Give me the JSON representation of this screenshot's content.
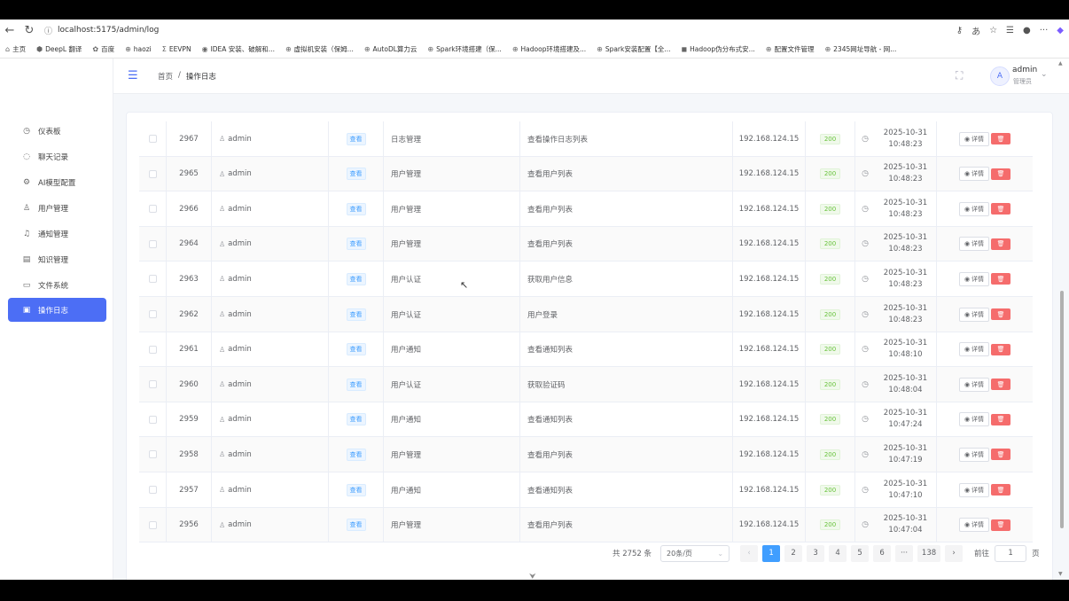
{
  "browser": {
    "url": "localhost:5175/admin/log",
    "bookmarks": [
      "主页",
      "DeepL 翻译",
      "百度",
      "haozi",
      "EEVPN",
      "IDEA 安装、破解和...",
      "虚拟机安装（保姆...",
      "AutoDL算力云",
      "Spark环境搭建（保...",
      "Hadoop环境搭建及...",
      "Spark安装配置【全...",
      "Hadoop伪分布式安...",
      "配置文件管理",
      "2345网址导航 - 网..."
    ]
  },
  "sidebar": {
    "items": [
      {
        "label": "仪表板",
        "icon": "dashboard-icon"
      },
      {
        "label": "聊天记录",
        "icon": "chat-icon"
      },
      {
        "label": "AI模型配置",
        "icon": "gear-icon"
      },
      {
        "label": "用户管理",
        "icon": "user-icon"
      },
      {
        "label": "通知管理",
        "icon": "bell-icon"
      },
      {
        "label": "知识管理",
        "icon": "document-icon"
      },
      {
        "label": "文件系统",
        "icon": "folder-icon"
      },
      {
        "label": "操作日志",
        "icon": "log-icon",
        "active": true
      }
    ]
  },
  "header": {
    "breadcrumb_home": "首页",
    "breadcrumb_sep": "/",
    "breadcrumb_current": "操作日志",
    "avatar_letter": "A",
    "user_name": "admin",
    "user_role": "管理员"
  },
  "table": {
    "rows": [
      {
        "id": "2967",
        "user": "admin",
        "op": "查看",
        "module": "日志管理",
        "desc": "查看操作日志列表",
        "ip": "192.168.124.15",
        "status": "200",
        "date": "2025-10-31",
        "time": "10:48:23"
      },
      {
        "id": "2965",
        "user": "admin",
        "op": "查看",
        "module": "用户管理",
        "desc": "查看用户列表",
        "ip": "192.168.124.15",
        "status": "200",
        "date": "2025-10-31",
        "time": "10:48:23"
      },
      {
        "id": "2966",
        "user": "admin",
        "op": "查看",
        "module": "用户管理",
        "desc": "查看用户列表",
        "ip": "192.168.124.15",
        "status": "200",
        "date": "2025-10-31",
        "time": "10:48:23"
      },
      {
        "id": "2964",
        "user": "admin",
        "op": "查看",
        "module": "用户管理",
        "desc": "查看用户列表",
        "ip": "192.168.124.15",
        "status": "200",
        "date": "2025-10-31",
        "time": "10:48:23"
      },
      {
        "id": "2963",
        "user": "admin",
        "op": "查看",
        "module": "用户认证",
        "desc": "获取用户信息",
        "ip": "192.168.124.15",
        "status": "200",
        "date": "2025-10-31",
        "time": "10:48:23"
      },
      {
        "id": "2962",
        "user": "admin",
        "op": "查看",
        "module": "用户认证",
        "desc": "用户登录",
        "ip": "192.168.124.15",
        "status": "200",
        "date": "2025-10-31",
        "time": "10:48:23"
      },
      {
        "id": "2961",
        "user": "admin",
        "op": "查看",
        "module": "用户通知",
        "desc": "查看通知列表",
        "ip": "192.168.124.15",
        "status": "200",
        "date": "2025-10-31",
        "time": "10:48:10"
      },
      {
        "id": "2960",
        "user": "admin",
        "op": "查看",
        "module": "用户认证",
        "desc": "获取验证码",
        "ip": "192.168.124.15",
        "status": "200",
        "date": "2025-10-31",
        "time": "10:48:04"
      },
      {
        "id": "2959",
        "user": "admin",
        "op": "查看",
        "module": "用户通知",
        "desc": "查看通知列表",
        "ip": "192.168.124.15",
        "status": "200",
        "date": "2025-10-31",
        "time": "10:47:24"
      },
      {
        "id": "2958",
        "user": "admin",
        "op": "查看",
        "module": "用户管理",
        "desc": "查看用户列表",
        "ip": "192.168.124.15",
        "status": "200",
        "date": "2025-10-31",
        "time": "10:47:19"
      },
      {
        "id": "2957",
        "user": "admin",
        "op": "查看",
        "module": "用户通知",
        "desc": "查看通知列表",
        "ip": "192.168.124.15",
        "status": "200",
        "date": "2025-10-31",
        "time": "10:47:10"
      },
      {
        "id": "2956",
        "user": "admin",
        "op": "查看",
        "module": "用户管理",
        "desc": "查看用户列表",
        "ip": "192.168.124.15",
        "status": "200",
        "date": "2025-10-31",
        "time": "10:47:04"
      }
    ],
    "detail_label": "详情",
    "delete_icon": "trash-icon"
  },
  "pagination": {
    "total": "共 2752 条",
    "page_size": "20条/页",
    "pages": [
      "1",
      "2",
      "3",
      "4",
      "5",
      "6"
    ],
    "ellipsis": "···",
    "last_page": "138",
    "current": "1",
    "goto_label": "前往",
    "goto_value": "1",
    "page_unit": "页"
  },
  "colors": {
    "accent": "#4c6ef5",
    "primary": "#409eff",
    "danger": "#f56c6c",
    "success": "#67c23a"
  }
}
